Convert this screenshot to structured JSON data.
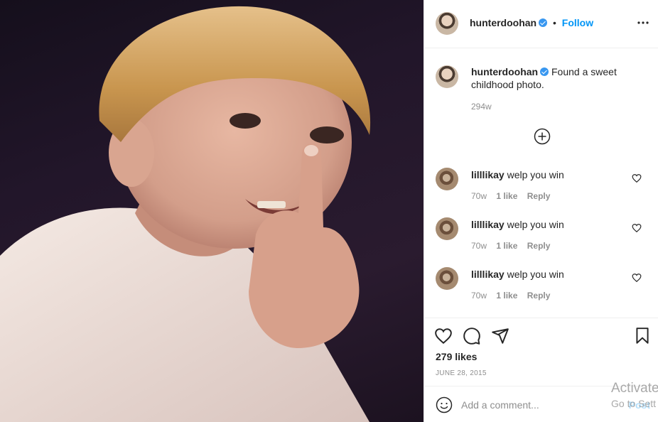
{
  "post": {
    "username": "hunterdoohan",
    "follow_separator": "•",
    "follow_label": "Follow",
    "caption": "Found a sweet childhood photo.",
    "caption_time": "294w",
    "likes": "279 likes",
    "date": "JUNE 28, 2015"
  },
  "comments": [
    {
      "username": "lilllikay",
      "text": "welp you win",
      "time": "70w",
      "likes": "1 like",
      "reply": "Reply"
    },
    {
      "username": "lilllikay",
      "text": "welp you win",
      "time": "70w",
      "likes": "1 like",
      "reply": "Reply"
    },
    {
      "username": "lilllikay",
      "text": "welp you win",
      "time": "70w",
      "likes": "1 like",
      "reply": "Reply"
    }
  ],
  "comment_box": {
    "placeholder": "Add a comment...",
    "post_label": "Post"
  },
  "watermark": {
    "line1": "Activate",
    "line2": "Go to Sett"
  },
  "icons": {
    "more": "more-options-icon",
    "add": "add-circle-icon",
    "heart": "heart-icon",
    "comment": "comment-icon",
    "share": "share-icon",
    "save": "bookmark-icon",
    "emoji": "emoji-icon"
  },
  "colors": {
    "accent": "#0095f6",
    "verified": "#3897f0",
    "text": "#262626",
    "muted": "#8e8e8e",
    "border": "#efefef"
  }
}
